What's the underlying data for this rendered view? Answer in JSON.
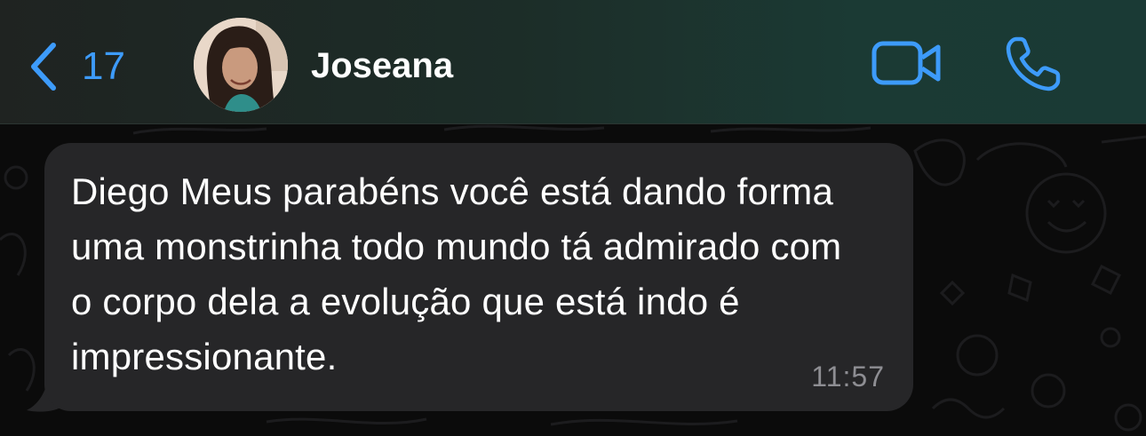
{
  "header": {
    "back_icon": "chevron-left-icon",
    "back_count": "17",
    "contact_name": "Joseana",
    "video_icon": "video-camera-icon",
    "call_icon": "phone-icon",
    "accent_color": "#3d9bfa"
  },
  "messages": [
    {
      "text": "Diego Meus parabéns você está dando forma uma monstrinha todo mundo tá admirado com o corpo dela a evolução que está indo é impressionante.",
      "time": "11:57",
      "direction": "incoming"
    }
  ]
}
